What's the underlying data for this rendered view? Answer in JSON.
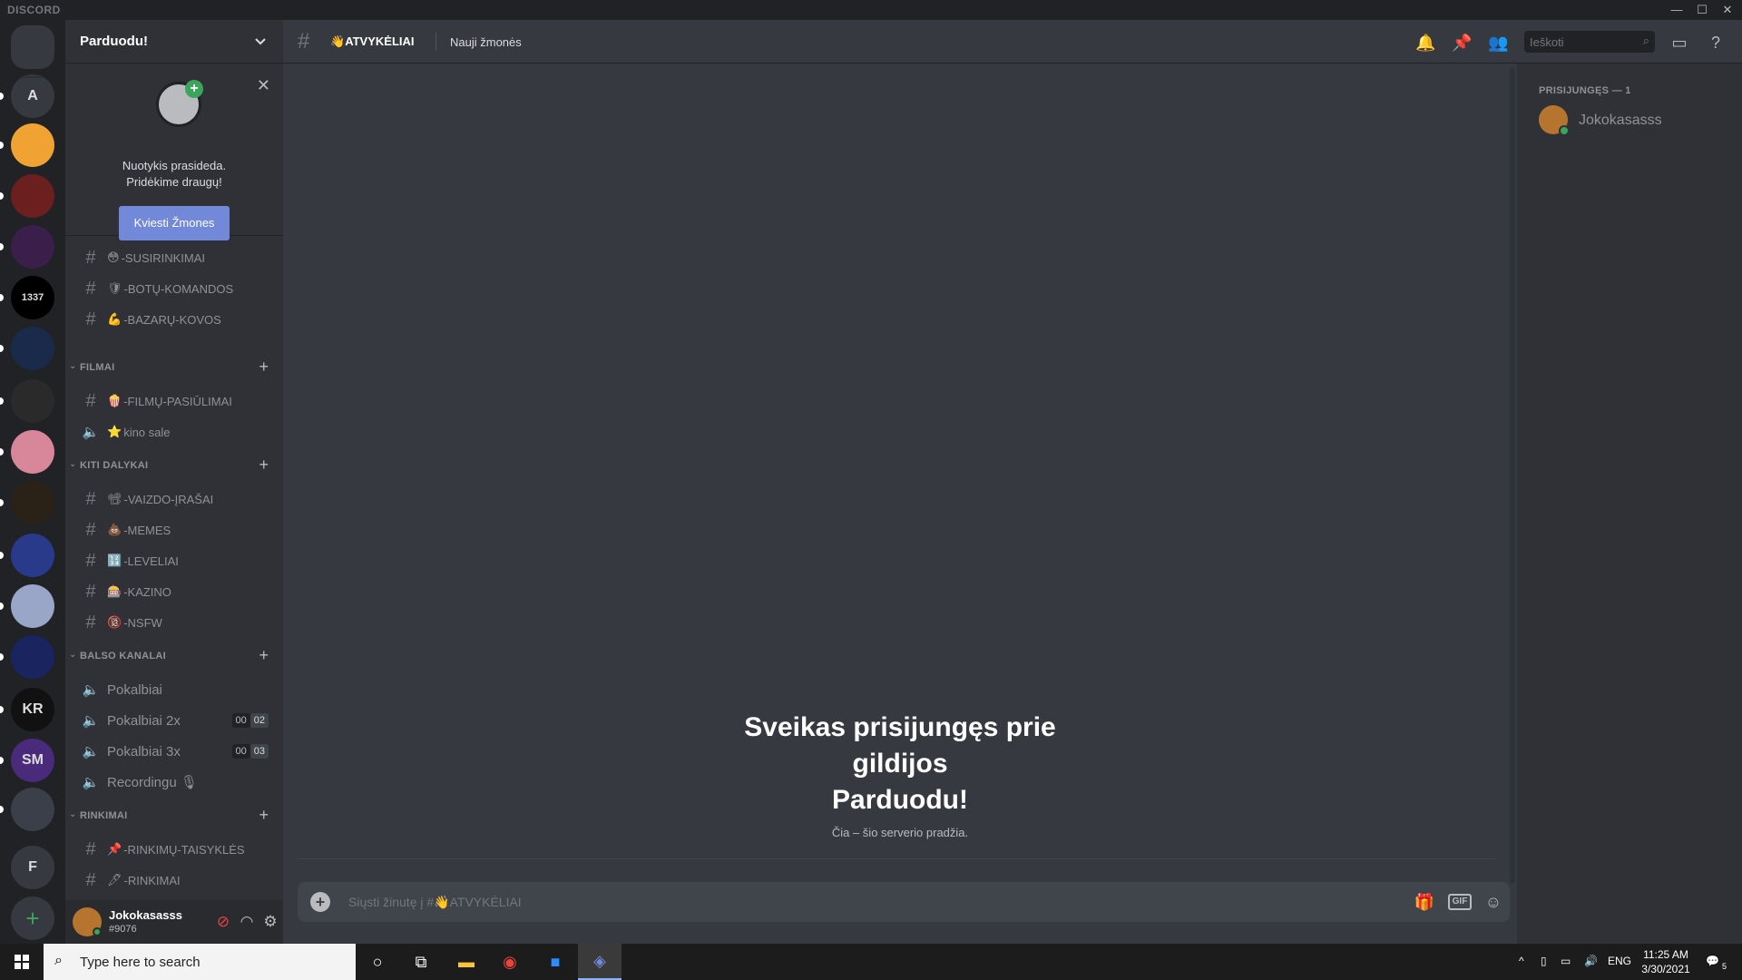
{
  "app": {
    "brand": "DISCORD"
  },
  "window_controls": {
    "minimize": "—",
    "maximize": "☐",
    "close": "✕"
  },
  "guilds": [
    {
      "letter": "",
      "color": "#36393f",
      "kind": "home"
    },
    {
      "letter": "A",
      "color": "#36393f"
    },
    {
      "letter": "",
      "color": "#f0a232"
    },
    {
      "letter": "",
      "color": "#6b1f1f"
    },
    {
      "letter": "",
      "color": "#3a1f4a"
    },
    {
      "letter": "1337",
      "color": "#000000"
    },
    {
      "letter": "",
      "color": "#1a2a4a"
    },
    {
      "letter": "",
      "color": "#2a2a2a"
    },
    {
      "letter": "",
      "color": "#d8869a"
    },
    {
      "letter": "",
      "color": "#2a2216"
    },
    {
      "letter": "",
      "color": "#2a3a8a"
    },
    {
      "letter": "",
      "color": "#9aa6c8"
    },
    {
      "letter": "",
      "color": "#1a2560"
    },
    {
      "letter": "KR",
      "color": "#111111"
    },
    {
      "letter": "SM",
      "color": "#4a2a7a"
    },
    {
      "letter": "",
      "color": "#3a3f4a"
    },
    {
      "letter": "F",
      "color": "#36393f"
    }
  ],
  "server": {
    "name": "Parduodu!"
  },
  "invite": {
    "line1": "Nuotykis prasideda.",
    "line2": "Pridėkime draugų!",
    "button": "Kviesti Žmones"
  },
  "channels_top": [
    {
      "emoji": "😳",
      "label": "-SUSIRINKIMAI",
      "type": "text"
    },
    {
      "emoji": "🛡",
      "label": "-BOTŲ-KOMANDOS",
      "type": "text"
    },
    {
      "emoji": "💪",
      "label": "-BAZARŲ-KOVOS",
      "type": "text"
    }
  ],
  "categories": {
    "filmai": "FILMAI",
    "kiti": "KITI DALYKAI",
    "balso": "BALSO KANALAI",
    "rinkimai": "RINKIMAI"
  },
  "channels_filmai": [
    {
      "emoji": "🍿",
      "label": "-FILMŲ-PASIŪLIMAI",
      "type": "text"
    },
    {
      "emoji": "⭐",
      "label": "kino sale",
      "type": "voice"
    }
  ],
  "channels_kiti": [
    {
      "emoji": "📽",
      "label": "-VAIZDO-ĮRAŠAI",
      "type": "text"
    },
    {
      "emoji": "💩",
      "label": "-MEMES",
      "type": "text"
    },
    {
      "emoji": "🔢",
      "label": "-LEVELIAI",
      "type": "text"
    },
    {
      "emoji": "🎰",
      "label": "-KAZINO",
      "type": "text"
    },
    {
      "emoji": "🔞",
      "label": "-NSFW",
      "type": "text"
    }
  ],
  "channels_balso": [
    {
      "label": "Pokalbiai",
      "type": "voice"
    },
    {
      "label": "Pokalbiai 2x",
      "type": "voice",
      "c1": "00",
      "c2": "02"
    },
    {
      "label": "Pokalbiai 3x",
      "type": "voice",
      "c1": "00",
      "c2": "03"
    },
    {
      "label": "Recordingu 🎙",
      "type": "voice"
    }
  ],
  "channels_rinkimai": [
    {
      "emoji": "📌",
      "label": "-RINKIMŲ-TAISYKLĖS",
      "type": "text"
    },
    {
      "emoji": "🖊",
      "label": "-RINKIMAI",
      "type": "text"
    }
  ],
  "user": {
    "name": "Jokokasasss",
    "tag": "#9076"
  },
  "channel_header": {
    "emoji": "👋",
    "name": "ATVYKĖLIAI",
    "topic": "Nauji žmonės",
    "search_placeholder": "Ieškoti"
  },
  "welcome": {
    "line1": "Sveikas prisijungęs prie",
    "line2": "gildijos",
    "line3": "Parduodu!",
    "sub": "Čia – šio serverio pradžia."
  },
  "composer": {
    "placeholder": "Siųsti žinutę į #👋ATVYKĖLIAI",
    "gif": "GIF"
  },
  "members": {
    "heading": "PRISIJUNGĘS — 1",
    "list": [
      {
        "name": "Jokokasasss"
      }
    ]
  },
  "taskbar": {
    "search_placeholder": "Type here to search",
    "lang": "ENG",
    "time": "11:25 AM",
    "date": "3/30/2021",
    "notif_count": "5"
  },
  "colors": {
    "accent": "#7289da",
    "online": "#3ba55c",
    "bg_main": "#36393f",
    "bg_sidebar": "#2f3136",
    "bg_guilds": "#202225"
  }
}
